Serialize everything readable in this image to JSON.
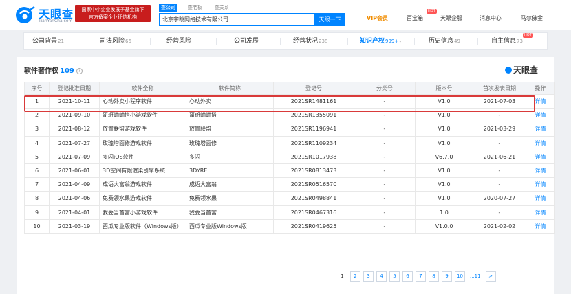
{
  "header": {
    "logo_text": "天眼查",
    "logo_sub": "TianYanCha.com",
    "promo_line1": "国家中小企业发展子基金旗下",
    "promo_line2": "官方备案企业征信机构",
    "search_tabs": [
      "查公司",
      "查老板",
      "查关系"
    ],
    "search_value": "北京字跳网络技术有限公司",
    "search_button": "天眼一下",
    "nav": {
      "vip": "VIP会员",
      "baiyoubao": "百宝箱",
      "tianyan": "天眼企服",
      "msg": "消息中心",
      "user": "马尔佛金",
      "hot": "HOT"
    }
  },
  "tabs": [
    {
      "label": "公司背景",
      "count": "21"
    },
    {
      "label": "司法风险",
      "count": "66"
    },
    {
      "label": "经营风险",
      "count": ""
    },
    {
      "label": "公司发展",
      "count": ""
    },
    {
      "label": "经营状况",
      "count": "238"
    },
    {
      "label": "知识产权",
      "count": "999+"
    },
    {
      "label": "历史信息",
      "count": "49"
    },
    {
      "label": "自主信息",
      "count": "73"
    }
  ],
  "section": {
    "title": "软件著作权",
    "count": "109",
    "brand": "天眼查"
  },
  "table": {
    "headers": [
      "序号",
      "登记批准日期",
      "软件全称",
      "软件简称",
      "登记号",
      "分类号",
      "版本号",
      "首次发表日期",
      "操作"
    ],
    "rows": [
      [
        "1",
        "2021-10-11",
        "心动外卖小程序软件",
        "心动外卖",
        "2021SR1481161",
        "-",
        "V1.0",
        "2021-07-03",
        "详情"
      ],
      [
        "2",
        "2021-09-10",
        "哥斑蛐蛐搭小游戏软件",
        "哥斑蛐蛐搭",
        "2021SR1355091",
        "-",
        "V1.0",
        "-",
        "详情"
      ],
      [
        "3",
        "2021-08-12",
        "放置联盟游戏软件",
        "放置联盟",
        "2021SR1196941",
        "-",
        "V1.0",
        "2021-03-29",
        "详情"
      ],
      [
        "4",
        "2021-07-27",
        "玫瑰塔面修游戏软件",
        "玫瑰塔面修",
        "2021SR1109234",
        "-",
        "V1.0",
        "-",
        "详情"
      ],
      [
        "5",
        "2021-07-09",
        "多闪iOS软件",
        "多闪",
        "2021SR1017938",
        "-",
        "V6.7.0",
        "2021-06-21",
        "详情"
      ],
      [
        "6",
        "2021-06-01",
        "3D空间有限渲染引擎系统",
        "3DYRE",
        "2021SR0813473",
        "-",
        "V1.0",
        "-",
        "详情"
      ],
      [
        "7",
        "2021-04-09",
        "成语大富翁游戏软件",
        "成语大富翁",
        "2021SR0516570",
        "-",
        "V1.0",
        "-",
        "详情"
      ],
      [
        "8",
        "2021-04-06",
        "免费领水果游戏软件",
        "免费领水果",
        "2021SR0498841",
        "-",
        "V1.0",
        "2020-07-27",
        "详情"
      ],
      [
        "9",
        "2021-04-01",
        "我要当首富小游戏软件",
        "我要当首富",
        "2021SR0467316",
        "-",
        "1.0",
        "-",
        "详情"
      ],
      [
        "10",
        "2021-03-19",
        "西瓜专业版软件（Windows版）",
        "西瓜专业版Windows版",
        "2021SR0419625",
        "-",
        "V1.0.0",
        "2021-02-02",
        "详情"
      ]
    ]
  },
  "pagination": [
    "1",
    "2",
    "3",
    "4",
    "5",
    "6",
    "7",
    "8",
    "9",
    "10",
    "...11",
    ">"
  ],
  "current_page": "1"
}
